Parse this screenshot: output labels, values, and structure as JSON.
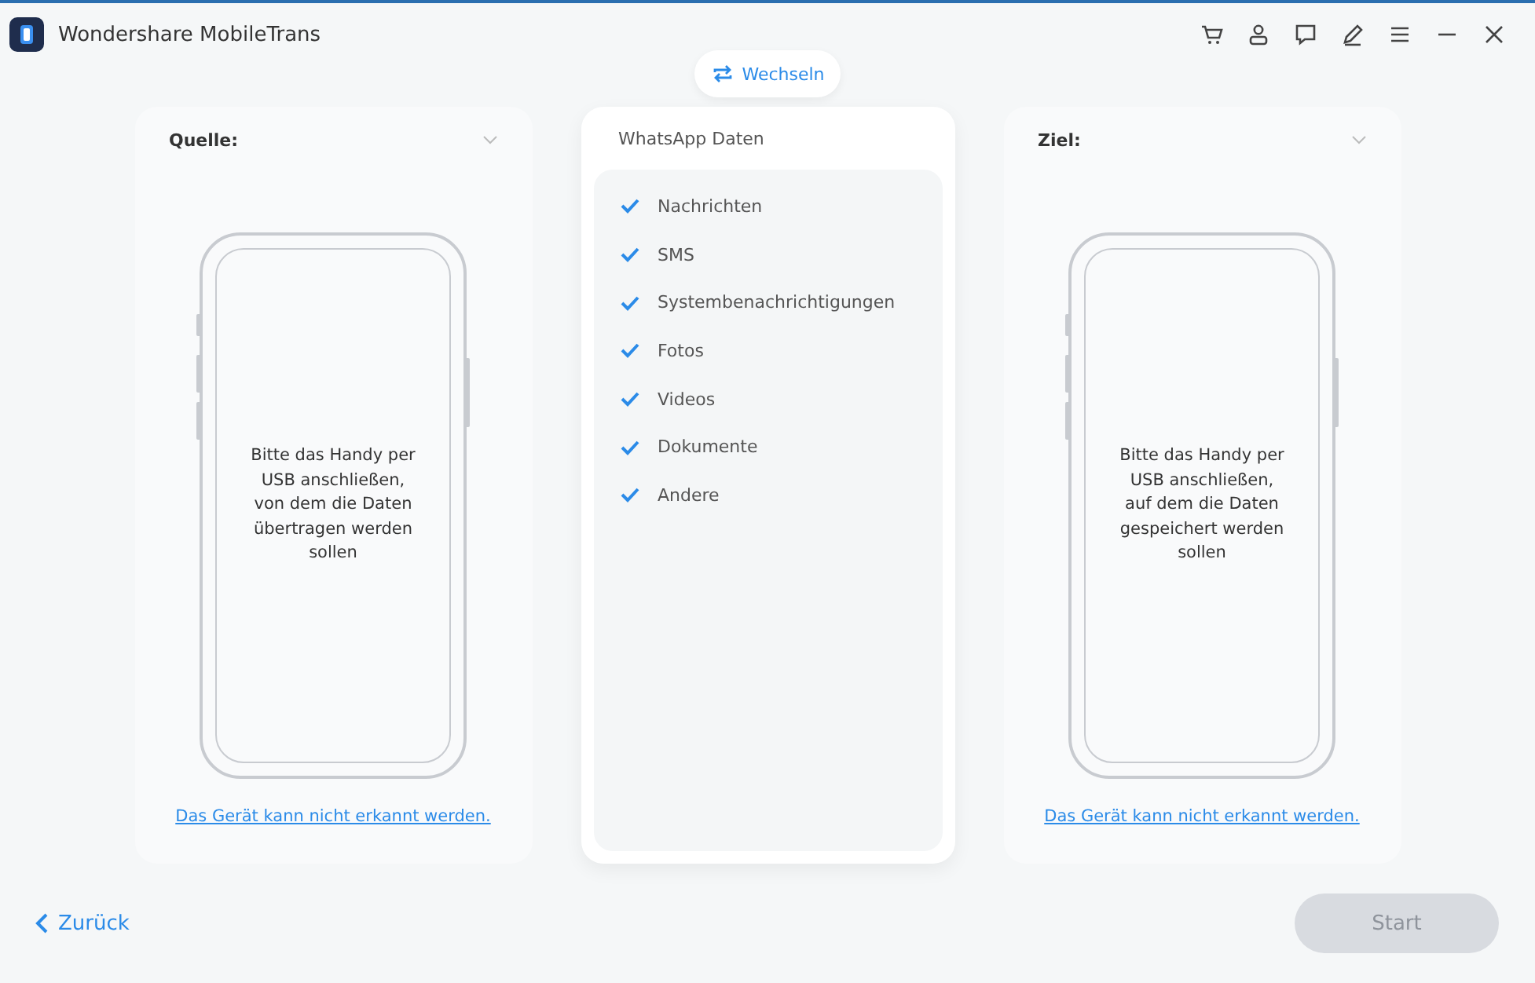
{
  "window": {
    "title": "Wondershare MobileTrans"
  },
  "toolbar": {
    "switch_label": "Wechseln"
  },
  "source": {
    "label": "Quelle:",
    "message": "Bitte das Handy per\nUSB anschließen,\nvon dem die Daten\nübertragen werden\nsollen",
    "link": "Das Gerät kann nicht erkannt werden."
  },
  "data_panel": {
    "title": "WhatsApp Daten",
    "items": [
      {
        "label": "Nachrichten",
        "checked": true
      },
      {
        "label": "SMS",
        "checked": true
      },
      {
        "label": "Systembenachrichtigungen",
        "checked": true
      },
      {
        "label": "Fotos",
        "checked": true
      },
      {
        "label": "Videos",
        "checked": true
      },
      {
        "label": "Dokumente",
        "checked": true
      },
      {
        "label": "Andere",
        "checked": true
      }
    ]
  },
  "target": {
    "label": "Ziel:",
    "message": "Bitte das Handy per\nUSB anschließen,\nauf dem die Daten\ngespeichert werden\nsollen",
    "link": "Das Gerät kann nicht erkannt werden."
  },
  "footer": {
    "back_label": "Zurück",
    "start": {
      "label": "Start",
      "disabled": true
    }
  }
}
